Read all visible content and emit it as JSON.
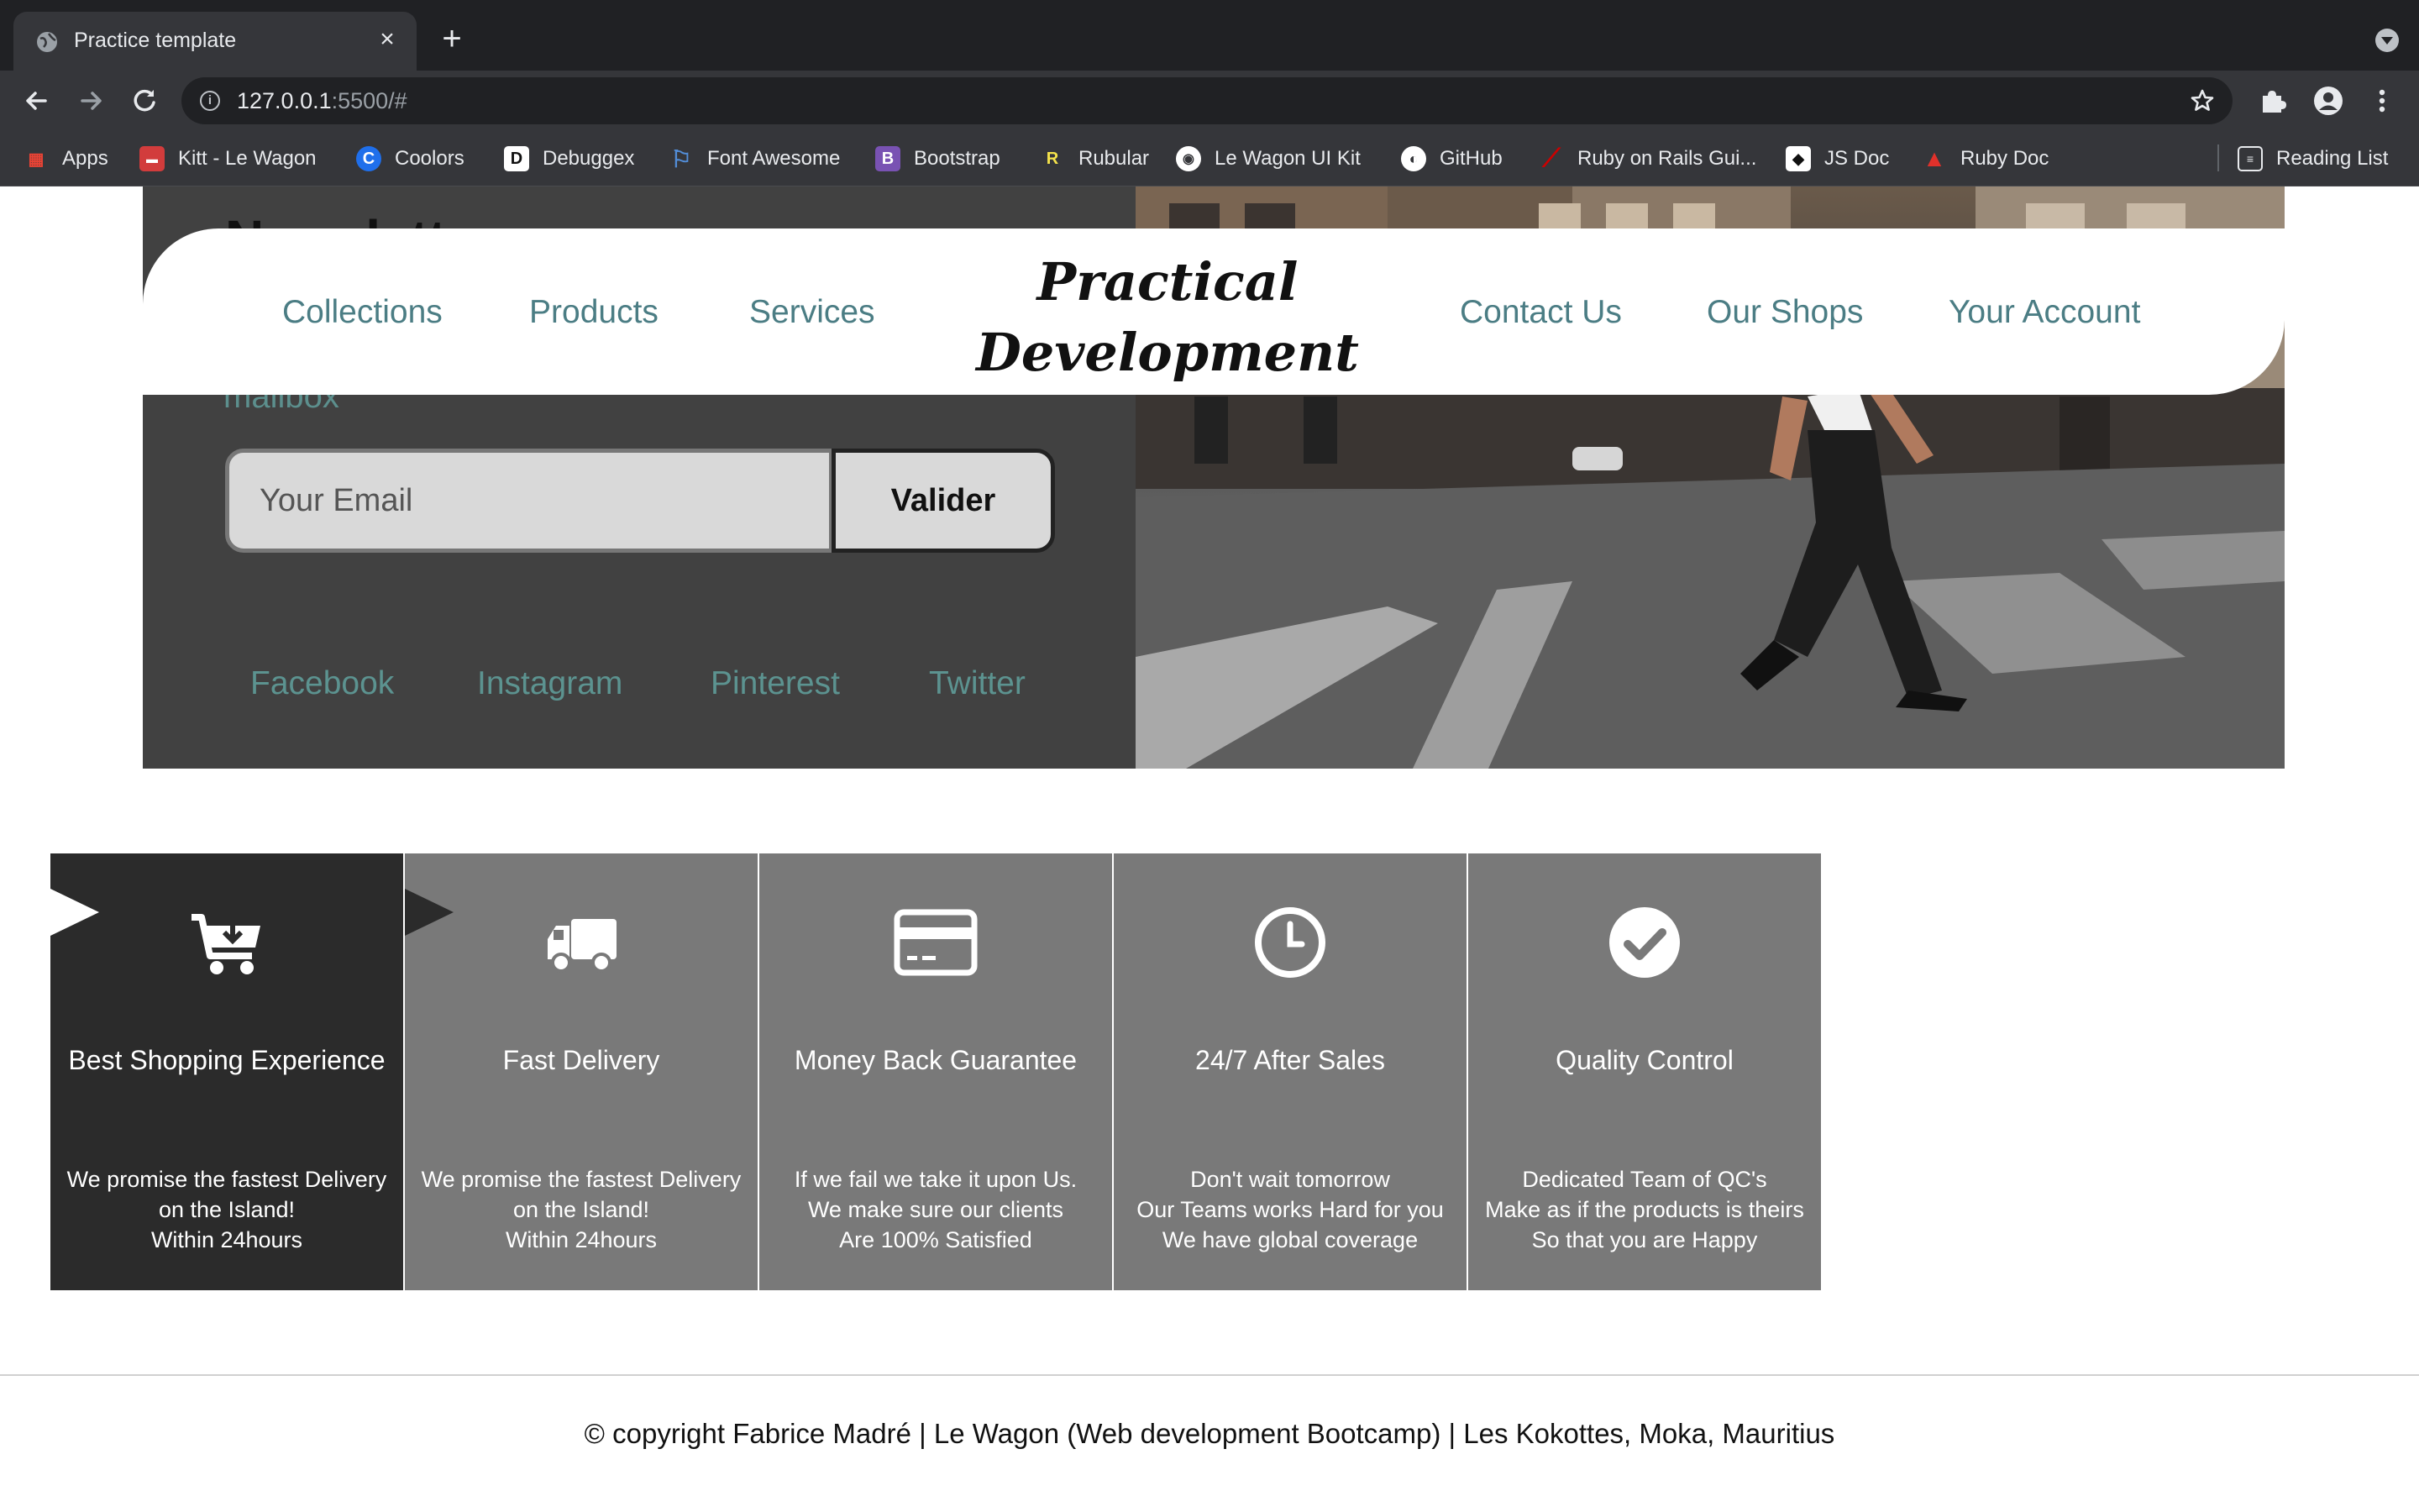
{
  "browser": {
    "tab_title": "Practice template",
    "new_tab_symbol": "+",
    "close_symbol": "×",
    "url_host": "127.0.0.1",
    "url_rest": ":5500/#",
    "info_symbol": "i",
    "icons": [
      "back-arrow-icon",
      "forward-arrow-icon",
      "reload-icon",
      "star-icon",
      "extensions-icon",
      "profile-icon",
      "kebab-menu-icon"
    ]
  },
  "bookmarks": {
    "items": [
      {
        "label": "Apps",
        "icon": "apps-grid-icon",
        "glyph": "▦",
        "color": "#ea4335"
      },
      {
        "label": "Kitt - Le Wagon",
        "icon": "le-wagon-icon",
        "glyph": "🚃",
        "color": "#d23c3c"
      },
      {
        "label": "Coolors",
        "icon": "coolors-icon",
        "glyph": "C",
        "color": "#1f6feb"
      },
      {
        "label": "Debuggex",
        "icon": "debuggex-icon",
        "glyph": "D",
        "color": "#ffffff"
      },
      {
        "label": "Font Awesome",
        "icon": "font-awesome-flag-icon",
        "glyph": "⚐",
        "color": "#528dd7"
      },
      {
        "label": "Bootstrap",
        "icon": "bootstrap-icon",
        "glyph": "B",
        "color": "#7952b3"
      },
      {
        "label": "Rubular",
        "icon": "rubular-icon",
        "glyph": "R",
        "color": "#f5e34b"
      },
      {
        "label": "Le Wagon UI Kit",
        "icon": "le-wagon-ui-kit-icon",
        "glyph": "◉",
        "color": "#ffffff"
      },
      {
        "label": "GitHub",
        "icon": "github-icon",
        "glyph": "◐",
        "color": "#ffffff"
      },
      {
        "label": "Ruby on Rails Gui...",
        "icon": "rails-icon",
        "glyph": "⟋",
        "color": "#cc0000"
      },
      {
        "label": "JS Doc",
        "icon": "js-doc-icon",
        "glyph": "◆",
        "color": "#ffffff"
      },
      {
        "label": "Ruby Doc",
        "icon": "ruby-doc-icon",
        "glyph": "▲",
        "color": "#e0312b"
      }
    ],
    "reading_list": "Reading List"
  },
  "newsletter": {
    "title": "Newsletter",
    "subtitle": "mailbox",
    "email_placeholder": "Your Email",
    "submit_label": "Valider",
    "social_links": [
      "Facebook",
      "Instagram",
      "Pinterest",
      "Twitter"
    ]
  },
  "navbar": {
    "left_links": [
      "Collections",
      "Products",
      "Services"
    ],
    "brand_line1": "Practical",
    "brand_line2": "Development",
    "right_links": [
      "Contact Us",
      "Our Shops",
      "Your Account"
    ]
  },
  "features": [
    {
      "title": "Best Shopping Experience",
      "icon": "cart-download-icon",
      "lines": [
        "We promise the fastest Delivery",
        "on the Island!",
        "Within 24hours"
      ]
    },
    {
      "title": "Fast Delivery",
      "icon": "truck-icon",
      "lines": [
        "We promise the fastest Delivery",
        "on the Island!",
        "Within 24hours"
      ]
    },
    {
      "title": "Money Back Guarantee",
      "icon": "credit-card-icon",
      "lines": [
        "If we fail we take it upon Us.",
        "We make sure our clients",
        "Are 100% Satisfied"
      ]
    },
    {
      "title": "24/7 After Sales",
      "icon": "clock-icon",
      "lines": [
        "Don't wait tomorrow",
        "Our Teams works Hard for you",
        "We have global coverage"
      ]
    },
    {
      "title": "Quality Control",
      "icon": "check-circle-icon",
      "lines": [
        "Dedicated Team of QC's",
        "Make as if the products is theirs",
        "So that you are Happy"
      ]
    }
  ],
  "footer": {
    "text": "© copyright Fabrice Madré | Le Wagon (Web development Bootcamp) | Les Kokottes, Moka, Mauritius"
  },
  "colors": {
    "link_teal": "#4b7d84",
    "panel_dark": "#414141",
    "feature_grey": "#797979",
    "feature_dark": "#2b2b2b"
  }
}
